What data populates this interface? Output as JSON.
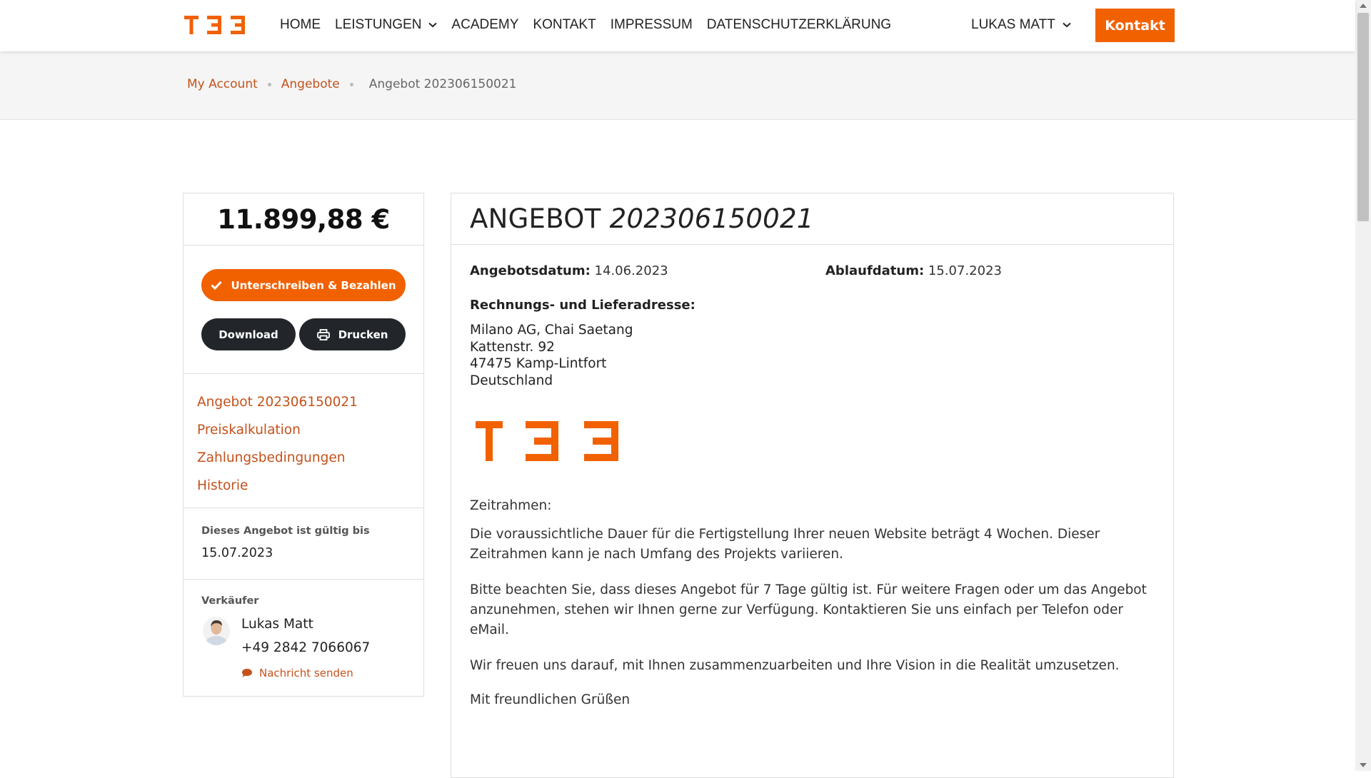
{
  "brand": {
    "accent": "#f26100",
    "link": "#c4511b",
    "dark": "#22262b",
    "logo_alt": "TBB"
  },
  "nav": {
    "items": [
      {
        "label": "HOME"
      },
      {
        "label": "LEISTUNGEN",
        "has_dropdown": true
      },
      {
        "label": "ACADEMY"
      },
      {
        "label": "KONTAKT"
      },
      {
        "label": "IMPRESSUM"
      },
      {
        "label": "DATENSCHUTZERKLÄRUNG"
      }
    ],
    "user": "LUKAS MATT",
    "cta": "Kontakt"
  },
  "breadcrumb": {
    "items": [
      "My Account",
      "Angebote"
    ],
    "current": "Angebot 202306150021"
  },
  "sidebar": {
    "price": "11.899,88 €",
    "sign_button": "Unterschreiben & Bezahlen",
    "download_button": "Download",
    "print_button": "Drucken",
    "links": [
      "Angebot 202306150021",
      "Preiskalkulation",
      "Zahlungsbedingungen",
      "Historie"
    ],
    "valid_label": "Dieses Angebot ist gültig bis",
    "valid_date": "15.07.2023",
    "seller_label": "Verkäufer",
    "seller_name": "Lukas Matt",
    "seller_phone": "+49 2842 7066067",
    "seller_message": "Nachricht senden"
  },
  "offer": {
    "title": "ANGEBOT",
    "number": "202306150021",
    "date_label": "Angebotsdatum:",
    "date": "14.06.2023",
    "expiry_label": "Ablaufdatum:",
    "expiry": "15.07.2023",
    "address_title": "Rechnungs- und Lieferadresse:",
    "address": [
      "Milano AG, Chai Saetang",
      "Kattenstr. 92",
      "47475 Kamp-Lintfort",
      "Deutschland"
    ],
    "timeframe_heading": "Zeitrahmen:",
    "paragraphs": [
      "Die voraussichtliche Dauer für die Fertigstellung Ihrer neuen Website beträgt 4 Wochen. Dieser Zeitrahmen kann je nach Umfang des Projekts variieren.",
      "Bitte beachten Sie, dass dieses Angebot für 7 Tage gültig ist. Für weitere Fragen oder um das Angebot anzunehmen, stehen wir Ihnen gerne zur Verfügung. Kontaktieren Sie uns einfach per Telefon oder eMail.",
      "Wir freuen uns darauf, mit Ihnen zusammenzuarbeiten und Ihre Vision in die Realität umzusetzen.",
      "Mit freundlichen Grüßen"
    ]
  }
}
